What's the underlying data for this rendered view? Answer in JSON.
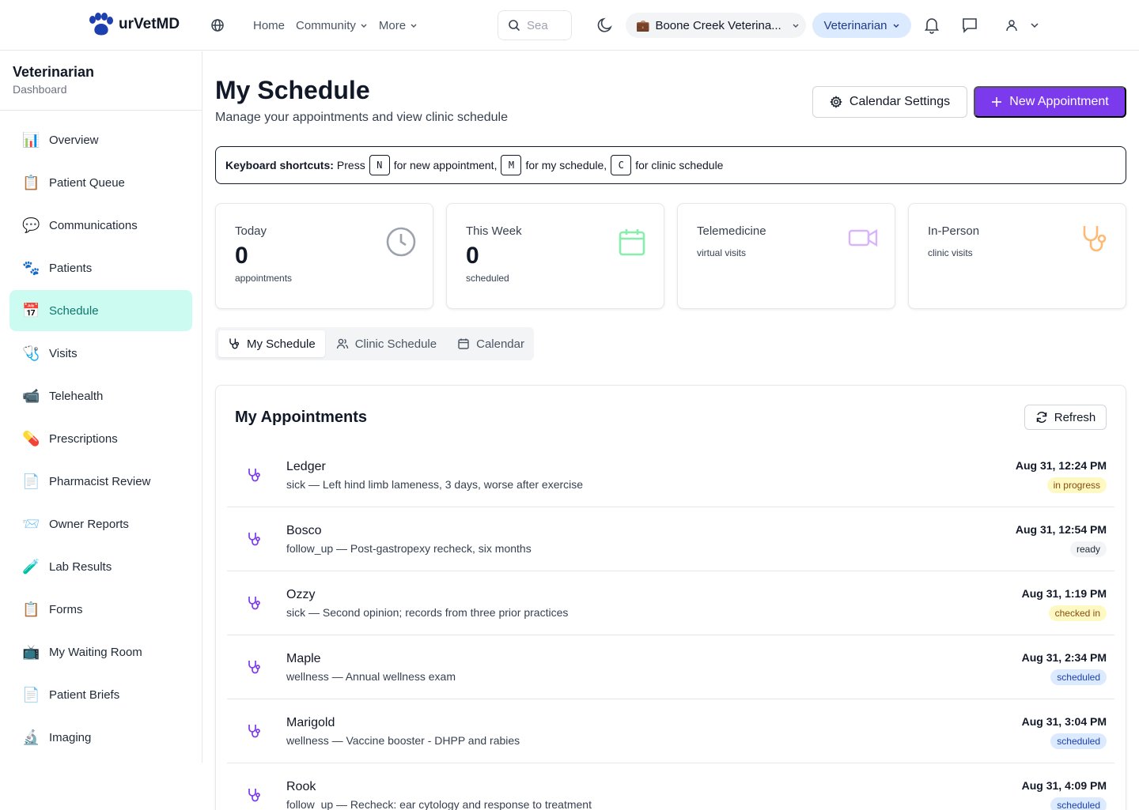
{
  "app": {
    "name": "urVetMD"
  },
  "topbar": {
    "nav": [
      {
        "label": "Home",
        "has_dropdown": false
      },
      {
        "label": "Community",
        "has_dropdown": true
      },
      {
        "label": "More",
        "has_dropdown": true
      }
    ],
    "search_placeholder": "Sea",
    "clinic": "Boone Creek Veterina...",
    "role": "Veterinarian"
  },
  "sidebar": {
    "title": "Veterinarian",
    "subtitle": "Dashboard",
    "active_index": 4,
    "items": [
      {
        "label": "Overview",
        "icon": "📊",
        "icon_name": "bar-chart-icon"
      },
      {
        "label": "Patient Queue",
        "icon": "📋",
        "icon_name": "clipboard-icon"
      },
      {
        "label": "Communications",
        "icon": "💬",
        "icon_name": "speech-bubble-icon"
      },
      {
        "label": "Patients",
        "icon": "🐾",
        "icon_name": "paw-icon"
      },
      {
        "label": "Schedule",
        "icon": "📅",
        "icon_name": "calendar-icon"
      },
      {
        "label": "Visits",
        "icon": "🩺",
        "icon_name": "stethoscope-icon"
      },
      {
        "label": "Telehealth",
        "icon": "📹",
        "icon_name": "video-camera-icon"
      },
      {
        "label": "Prescriptions",
        "icon": "💊",
        "icon_name": "pill-icon"
      },
      {
        "label": "Pharmacist Review",
        "icon": "📄",
        "icon_name": "document-icon"
      },
      {
        "label": "Owner Reports",
        "icon": "📨",
        "icon_name": "envelope-icon"
      },
      {
        "label": "Lab Results",
        "icon": "🧪",
        "icon_name": "test-tube-icon"
      },
      {
        "label": "Forms",
        "icon": "📋",
        "icon_name": "clipboard-icon"
      },
      {
        "label": "My Waiting Room",
        "icon": "📺",
        "icon_name": "television-icon"
      },
      {
        "label": "Patient Briefs",
        "icon": "📄",
        "icon_name": "document-icon"
      },
      {
        "label": "Imaging",
        "icon": "🔬",
        "icon_name": "microscope-icon"
      }
    ]
  },
  "header": {
    "title": "My Schedule",
    "subtitle": "Manage your appointments and view clinic schedule",
    "settings_label": "Calendar Settings",
    "new_label": "New Appointment"
  },
  "shortcuts": {
    "lead": "Keyboard shortcuts:",
    "press": "Press",
    "keys": [
      {
        "key": "N",
        "text": "for new appointment,"
      },
      {
        "key": "M",
        "text": "for my schedule,"
      },
      {
        "key": "C",
        "text": "for clinic schedule"
      }
    ]
  },
  "stats": [
    {
      "label": "Today",
      "value": "0",
      "unit": "appointments",
      "icon_name": "clock-icon",
      "color": "#9ca3af"
    },
    {
      "label": "This Week",
      "value": "0",
      "unit": "scheduled",
      "icon_name": "calendar-icon",
      "color": "#86efac"
    },
    {
      "label": "Telemedicine",
      "value": "",
      "unit": "virtual visits",
      "icon_name": "video-icon",
      "color": "#d8b4fe"
    },
    {
      "label": "In-Person",
      "value": "",
      "unit": "clinic visits",
      "icon_name": "stethoscope-icon",
      "color": "#fdba74"
    }
  ],
  "tabs": [
    {
      "label": "My Schedule",
      "active": true,
      "icon_name": "stethoscope-icon"
    },
    {
      "label": "Clinic Schedule",
      "active": false,
      "icon_name": "users-icon"
    },
    {
      "label": "Calendar",
      "active": false,
      "icon_name": "calendar-icon"
    }
  ],
  "appointments": {
    "title": "My Appointments",
    "refresh_label": "Refresh",
    "items": [
      {
        "name": "Ledger",
        "desc": "sick — Left hind limb lameness, 3 days, worse after exercise",
        "time": "Aug 31, 12:24 PM",
        "status": "in progress",
        "status_kind": "progress"
      },
      {
        "name": "Bosco",
        "desc": "follow_up — Post-gastropexy recheck, six months",
        "time": "Aug 31, 12:54 PM",
        "status": "ready",
        "status_kind": "ready"
      },
      {
        "name": "Ozzy",
        "desc": "sick — Second opinion; records from three prior practices",
        "time": "Aug 31, 1:19 PM",
        "status": "checked in",
        "status_kind": "checked"
      },
      {
        "name": "Maple",
        "desc": "wellness — Annual wellness exam",
        "time": "Aug 31, 2:34 PM",
        "status": "scheduled",
        "status_kind": "scheduled"
      },
      {
        "name": "Marigold",
        "desc": "wellness — Vaccine booster - DHPP and rabies",
        "time": "Aug 31, 3:04 PM",
        "status": "scheduled",
        "status_kind": "scheduled"
      },
      {
        "name": "Rook",
        "desc": "follow_up — Recheck: ear cytology and response to treatment",
        "time": "Aug 31, 4:09 PM",
        "status": "scheduled",
        "status_kind": "scheduled"
      }
    ]
  },
  "colors": {
    "accent": "#7c3aed",
    "active_nav_bg": "#ccfbf1",
    "active_nav_text": "#0f766e",
    "brand_logo": "#1e40af"
  }
}
